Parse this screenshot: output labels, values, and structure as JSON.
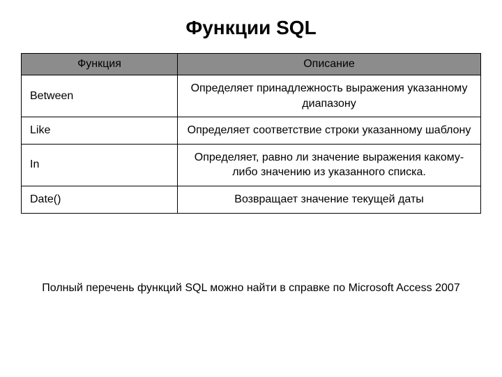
{
  "title": "Функции SQL",
  "headers": {
    "fn": "Функция",
    "desc": "Описание"
  },
  "rows": [
    {
      "fn": "Between",
      "desc": "Определяет принадлежность выражения указанному диапазону"
    },
    {
      "fn": "Like",
      "desc": "Определяет соответствие строки указанному шаблону"
    },
    {
      "fn": "In",
      "desc": "Определяет, равно ли значение выражения какому-либо значению из указанного списка."
    },
    {
      "fn": "Date()",
      "desc": "Возвращает значение текущей даты"
    }
  ],
  "footnote": "Полный перечень функций SQL можно найти в справке по Microsoft Access 2007"
}
